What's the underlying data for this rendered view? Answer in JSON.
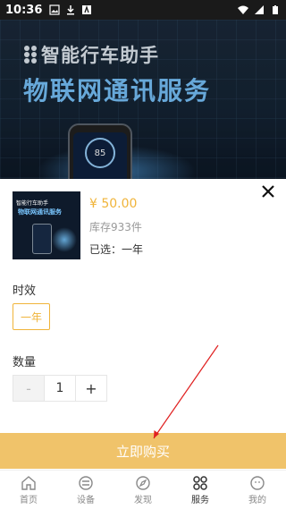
{
  "status_bar": {
    "time": "10:36"
  },
  "product": {
    "price": "¥ 50.00",
    "stock": "库存933件",
    "selected": "已选：一年",
    "thumb_title": "智能行车助手",
    "thumb_subtitle": "物联网通讯服务"
  },
  "banner": {
    "title": "智能行车助手",
    "subtitle": "物联网通讯服务",
    "speed": "85"
  },
  "spec": {
    "label": "时效",
    "options": [
      "一年"
    ]
  },
  "quantity": {
    "label": "数量",
    "value": "1",
    "minus": "-",
    "plus": "+"
  },
  "buy_button": "立即购买",
  "tabs": [
    {
      "label": "首页",
      "icon": "home-icon"
    },
    {
      "label": "设备",
      "icon": "device-icon"
    },
    {
      "label": "发现",
      "icon": "compass-icon"
    },
    {
      "label": "服务",
      "icon": "service-icon",
      "active": true
    },
    {
      "label": "我的",
      "icon": "profile-icon"
    }
  ],
  "colors": {
    "accent": "#f0b43a",
    "buy_button_bg": "#f0c36a",
    "banner_blue": "#79c6ff"
  }
}
